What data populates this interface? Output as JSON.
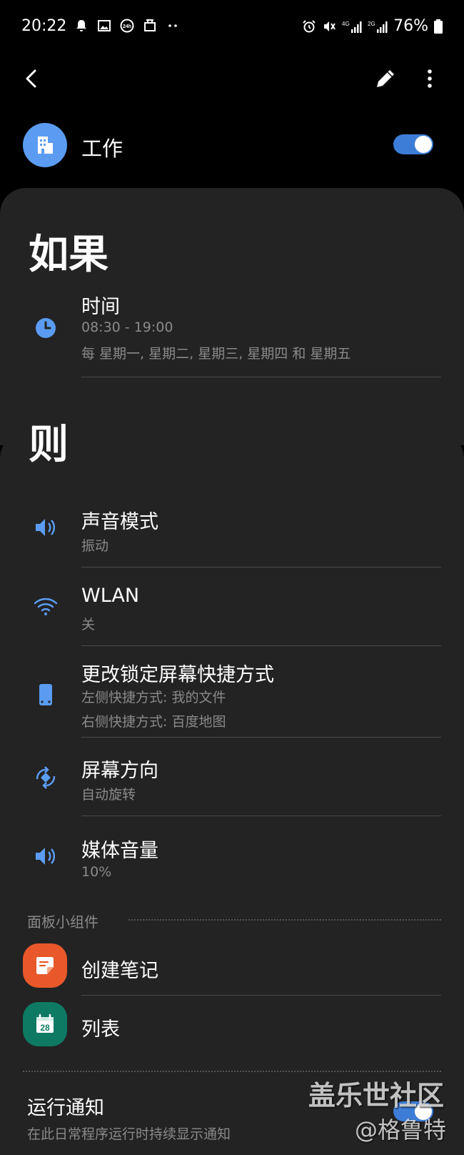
{
  "status_bar": {
    "time": "20:22",
    "battery_percent": "76%",
    "left_icons": [
      "bell-icon",
      "image-icon",
      "24h-icon",
      "work-icon",
      "more-dots-icon"
    ],
    "right_icons": [
      "alarm-icon",
      "mute-vibrate-icon",
      "4g-signal-icon",
      "2g-signal-icon",
      "battery-icon"
    ]
  },
  "routine": {
    "title": "工作",
    "enabled": true,
    "accent_color": "#5b9cf2"
  },
  "if_section": {
    "heading": "如果",
    "conditions": [
      {
        "icon": "clock-icon",
        "title": "时间",
        "lines": [
          "08:30 - 19:00",
          "每 星期一, 星期二, 星期三, 星期四 和 星期五"
        ]
      }
    ]
  },
  "then_section": {
    "heading": "则",
    "actions": [
      {
        "icon": "volume-icon",
        "title": "声音模式",
        "lines": [
          "振动"
        ]
      },
      {
        "icon": "wifi-icon",
        "title": "WLAN",
        "lines": [
          "关"
        ]
      },
      {
        "icon": "phone-icon",
        "title": "更改锁定屏幕快捷方式",
        "lines": [
          "左侧快捷方式: 我的文件",
          "右侧快捷方式: 百度地图"
        ]
      },
      {
        "icon": "rotate-icon",
        "title": "屏幕方向",
        "lines": [
          "自动旋转"
        ]
      },
      {
        "icon": "volume-icon",
        "title": "媒体音量",
        "lines": [
          "10%"
        ]
      }
    ]
  },
  "widgets": {
    "label": "面板小组件",
    "items": [
      {
        "icon": "note-icon",
        "label": "创建笔记",
        "color": "#e8582a"
      },
      {
        "icon": "calendar-icon",
        "label": "列表",
        "color": "#0e7a63",
        "badge": "28"
      }
    ]
  },
  "run_notification": {
    "title": "运行通知",
    "subtitle": "在此日常程序运行时持续显示通知",
    "enabled": true
  },
  "watermark": {
    "line1": "盖乐世社区",
    "line2": "@格鲁特"
  }
}
